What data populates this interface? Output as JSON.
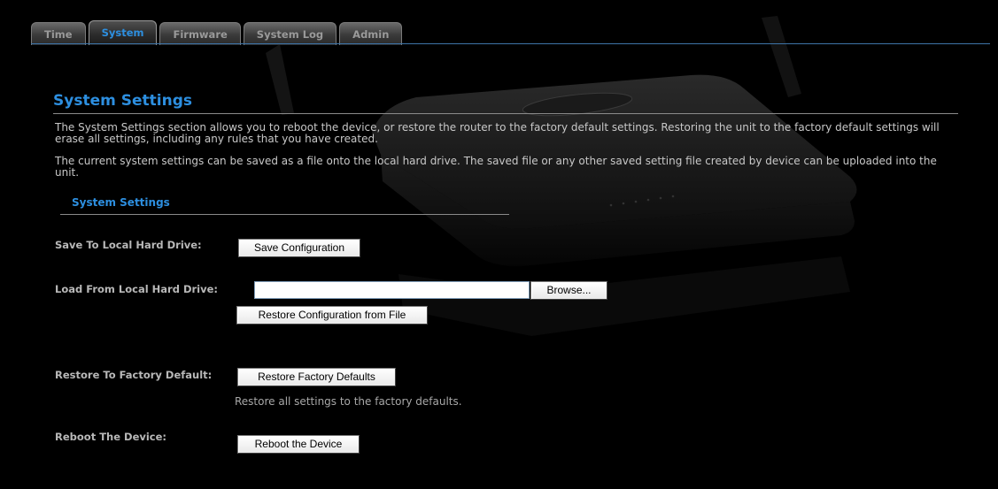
{
  "tabs": [
    {
      "label": "Time",
      "active": false
    },
    {
      "label": "System",
      "active": true
    },
    {
      "label": "Firmware",
      "active": false
    },
    {
      "label": "System Log",
      "active": false
    },
    {
      "label": "Admin",
      "active": false
    }
  ],
  "page": {
    "title": "System Settings",
    "description1": "The System Settings section allows you to reboot the device, or restore the router to the factory default settings. Restoring the unit to the factory default settings will erase all settings, including any rules that you have created.",
    "description2": "The current system settings can be saved as a file onto the local hard drive. The saved file or any other saved setting file created by device can be uploaded into the unit.",
    "section_title": "System Settings"
  },
  "rows": {
    "save_label": "Save To Local Hard Drive:",
    "save_button": "Save Configuration",
    "load_label": "Load From Local Hard Drive:",
    "file_value": "",
    "browse_button": "Browse...",
    "restore_file_button": "Restore Configuration from File",
    "factory_label": "Restore To Factory Default:",
    "factory_button": "Restore Factory Defaults",
    "factory_hint": "Restore all settings to the factory defaults.",
    "reboot_label": "Reboot The Device:",
    "reboot_button": "Reboot the Device"
  },
  "colors": {
    "accent": "#2d8fe0",
    "background": "#000000",
    "text": "#c8c8c8"
  }
}
